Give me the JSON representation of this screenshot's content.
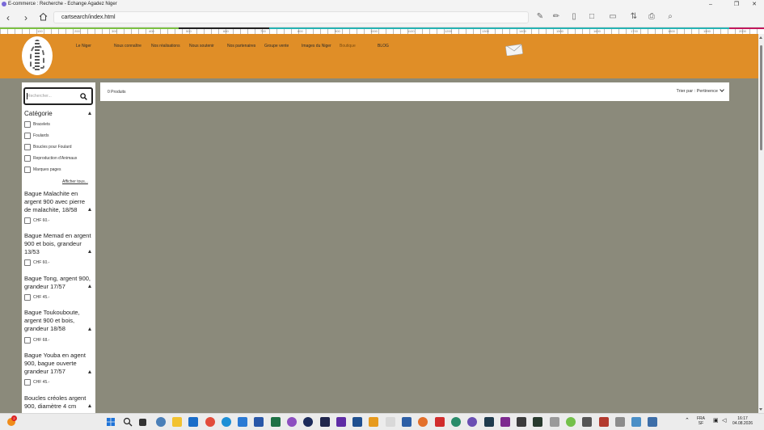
{
  "window": {
    "title": "E-commerce : Recherche - Echange Agadez Niger",
    "minimize": "–",
    "restore": "❐",
    "close": "✕"
  },
  "browser": {
    "url": "cartsearch/index.html"
  },
  "ruler": {
    "labels": [
      "100",
      "200",
      "300",
      "400",
      "500",
      "600",
      "700",
      "800",
      "900",
      "1000",
      "1100",
      "1200",
      "1300",
      "1400",
      "1500",
      "1600",
      "1700",
      "1800",
      "1900",
      "2000"
    ]
  },
  "site": {
    "menu": [
      "Le Niger",
      "Nous connaître",
      "Nos réalisations",
      "Nous soutenir",
      "Nos partenaires",
      "Groupe vente",
      "Images du Niger",
      "Boutique",
      "BLOG"
    ],
    "header_color": "#e08e27",
    "page_bg": "#8b8a7b"
  },
  "sidebar": {
    "search_placeholder": "Rechercher...",
    "category_title": "Catégorie",
    "categories": [
      "Bracelets",
      "Foulards",
      "Boucles pour Foulard",
      "Reproduction d'Animaux",
      "Marques pages"
    ],
    "show_all": "Afficher tous...",
    "products": [
      {
        "title": "Bague Malachite en argent 900 avec pierre de malachite, 18/58",
        "price": "CHF 60.-"
      },
      {
        "title": "Bague Memad en argent 900 et bois, grandeur 13/53",
        "price": "CHF 60.-"
      },
      {
        "title": "Bague Tong, argent 900, grandeur 17/57",
        "price": "CHF 45.-"
      },
      {
        "title": "Bague Toukouboute, argent 900 et bois, grandeur 18/58",
        "price": "CHF 68.-"
      },
      {
        "title": "Bague Youba en agent 900, bague ouverte grandeur 17/57",
        "price": "CHF 45.-"
      },
      {
        "title": "Boucles créoles argent 900, diamètre 4 cm",
        "price": ""
      }
    ]
  },
  "results": {
    "count_label": "0 Produits",
    "sort_label": "Trier par : Pertinence"
  },
  "taskbar": {
    "language": "FRA",
    "language_sub": "SF",
    "time": "16:17",
    "date": "04.08.2026",
    "notification_count": "2"
  }
}
